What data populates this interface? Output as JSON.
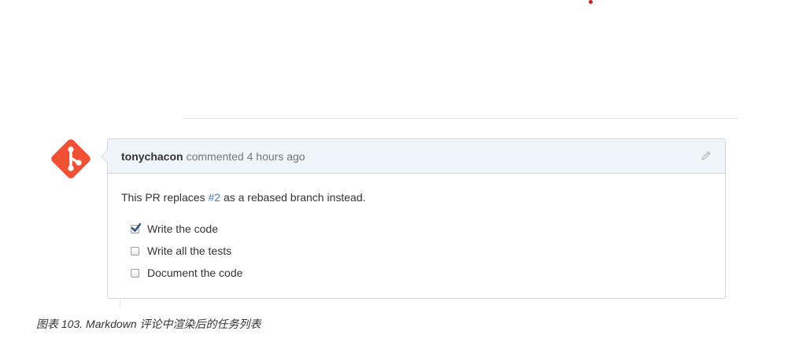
{
  "comment": {
    "author": "tonychacon",
    "meta": "commented 4 hours ago",
    "body": {
      "prefix": "This PR replaces ",
      "link": "#2",
      "suffix": " as a rebased branch instead."
    },
    "tasks": [
      {
        "label": "Write the code",
        "checked": true
      },
      {
        "label": "Write all the tests",
        "checked": false
      },
      {
        "label": "Document the code",
        "checked": false
      }
    ]
  },
  "caption": "图表 103. Markdown 评论中渲染后的任务列表",
  "colors": {
    "avatar": "#f05033",
    "header_bg": "#eef5fb",
    "link": "#4078c0",
    "check": "#2b4f8a"
  }
}
